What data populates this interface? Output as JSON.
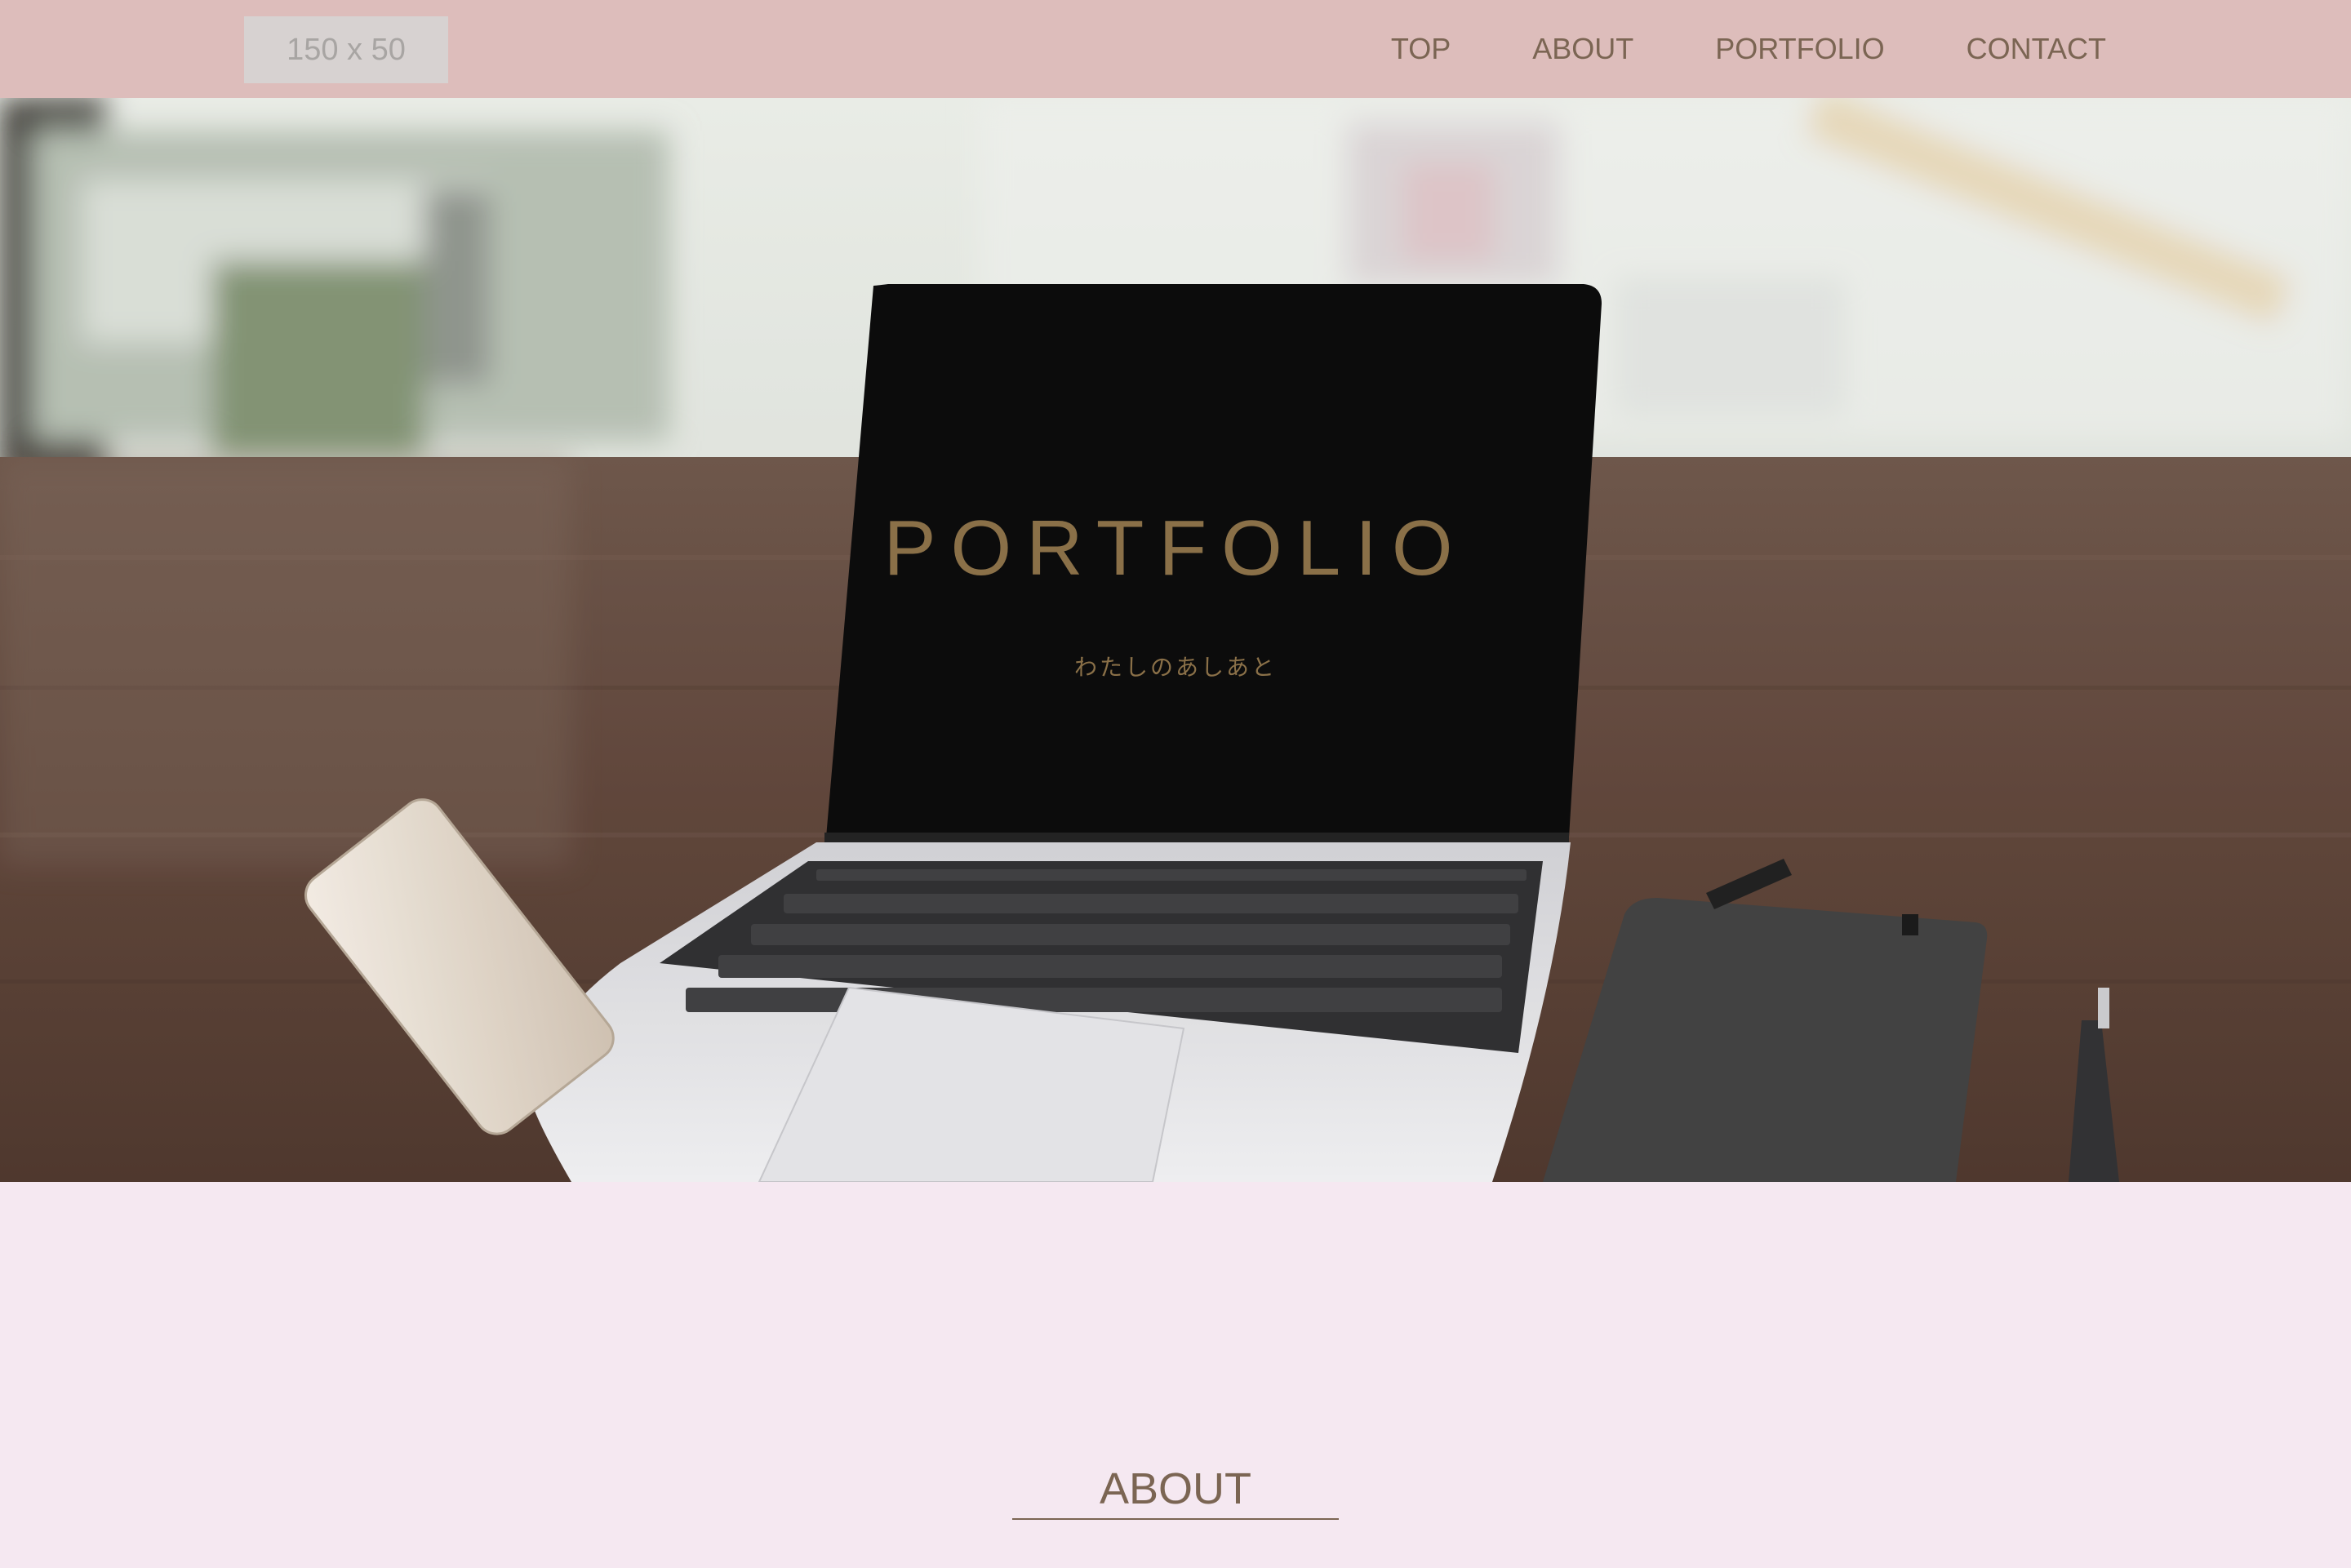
{
  "header": {
    "logo_text": "150 x 50",
    "nav": [
      {
        "label": "TOP"
      },
      {
        "label": "ABOUT"
      },
      {
        "label": "PORTFOLIO"
      },
      {
        "label": "CONTACT"
      }
    ]
  },
  "hero": {
    "title": "PORTFOLIO",
    "subtitle": "わたしのあしあと"
  },
  "about": {
    "heading": "ABOUT"
  },
  "colors": {
    "header_bg": "#ddbdbb",
    "page_bg": "#f5e8f1",
    "accent_text": "#7b6553",
    "hero_text": "#8a7048"
  }
}
